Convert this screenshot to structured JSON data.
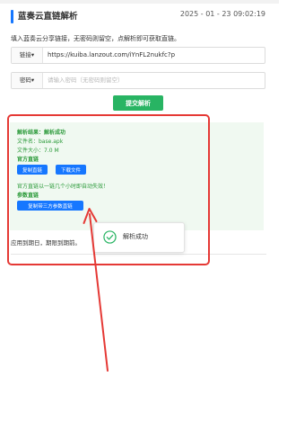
{
  "header": {
    "title": "蓝奏云直链解析",
    "timestamp": "2025 - 01 - 23 09:02:19"
  },
  "form": {
    "hint": "填入蓝奏云分享链接，无密码则留空，点解析即可获取直链。",
    "url_prefix": "链接",
    "url_value": "https://kuiba.lanzout.com/iYnFL2nukfc?p",
    "password_prefix": "密码",
    "password_placeholder": "请输入密码（无密码则留空）",
    "submit_label": "提交解析"
  },
  "result": {
    "status": "解析结果：解析成功",
    "file_name": "文件名：base.apk",
    "file_size": "文件大小：7.0 M",
    "direct_heading": "官方直链",
    "copy_direct_label": "复制直链",
    "download_label": "下载文件",
    "note": "官方直链以一链几个小时即自动失效！",
    "param_heading": "参数直链",
    "copy_param_label": "复制带三方参数直链"
  },
  "footer": {
    "note": "应用到期日，期限到期前。"
  },
  "toast": {
    "text": "解析成功"
  },
  "colors": {
    "accent_blue": "#1677ff",
    "success_green": "#28b463",
    "annotation_red": "#e53935"
  },
  "icons": {
    "toast": "check-circle-icon"
  }
}
